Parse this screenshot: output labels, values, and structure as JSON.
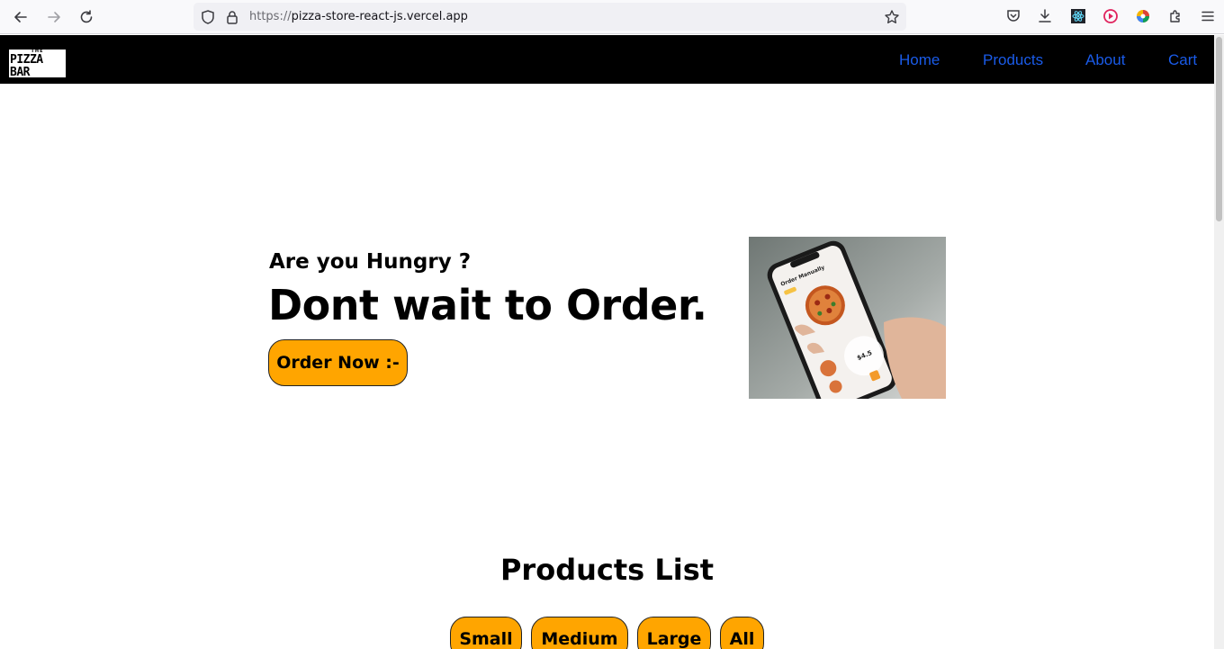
{
  "browser": {
    "url_protocol": "https://",
    "url_host": "pizza-store-react-js.vercel.app"
  },
  "site": {
    "logo_top": "THE",
    "logo_main": "PIZZA BAR",
    "nav": [
      {
        "label": "Home"
      },
      {
        "label": "Products"
      },
      {
        "label": "About"
      },
      {
        "label": "Cart"
      }
    ],
    "link_color": "#1a5be8",
    "accent": "#ffa500"
  },
  "hero": {
    "subtitle": "Are you Hungry ?",
    "title": "Dont wait to Order.",
    "cta": "Order Now :-",
    "image_screen_title": "Order Manually",
    "image_price": "$4.5"
  },
  "products": {
    "title": "Products List",
    "filters": [
      {
        "label": "Small"
      },
      {
        "label": "Medium"
      },
      {
        "label": "Large"
      },
      {
        "label": "All"
      }
    ]
  }
}
